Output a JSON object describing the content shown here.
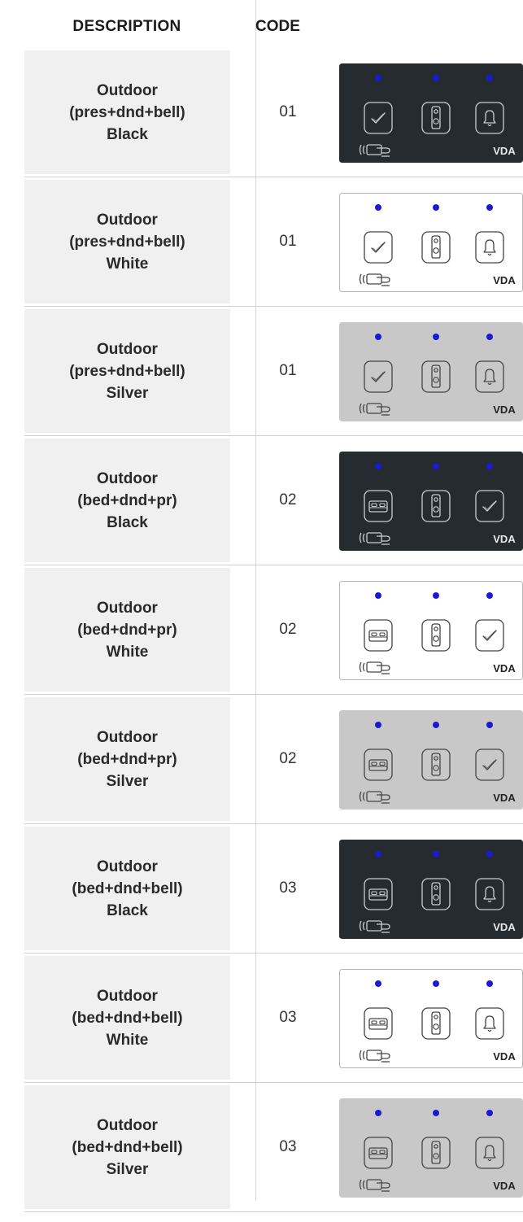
{
  "header": {
    "description": "DESCRIPTION",
    "code": "CODE"
  },
  "colors": {
    "black": "#262b30",
    "white": "#ffffff",
    "silver": "#c8c8c8",
    "led": "#1a1ad6"
  },
  "rows": [
    {
      "line1": "Outdoor",
      "line2": "(pres+dnd+bell)",
      "line3": "Black",
      "code": "01",
      "finish": "black",
      "icons": [
        "check-icon",
        "door-hanger-icon",
        "bell-icon"
      ]
    },
    {
      "line1": "Outdoor",
      "line2": "(pres+dnd+bell)",
      "line3": "White",
      "code": "01",
      "finish": "white",
      "icons": [
        "check-icon",
        "door-hanger-icon",
        "bell-icon"
      ]
    },
    {
      "line1": "Outdoor",
      "line2": "(pres+dnd+bell)",
      "line3": "Silver",
      "code": "01",
      "finish": "silver",
      "icons": [
        "check-icon",
        "door-hanger-icon",
        "bell-icon"
      ]
    },
    {
      "line1": "Outdoor",
      "line2": "(bed+dnd+pr)",
      "line3": "Black",
      "code": "02",
      "finish": "black",
      "icons": [
        "bed-icon",
        "door-hanger-icon",
        "check-icon"
      ]
    },
    {
      "line1": "Outdoor",
      "line2": "(bed+dnd+pr)",
      "line3": "White",
      "code": "02",
      "finish": "white",
      "icons": [
        "bed-icon",
        "door-hanger-icon",
        "check-icon"
      ]
    },
    {
      "line1": "Outdoor",
      "line2": "(bed+dnd+pr)",
      "line3": "Silver",
      "code": "02",
      "finish": "silver",
      "icons": [
        "bed-icon",
        "door-hanger-icon",
        "check-icon"
      ]
    },
    {
      "line1": "Outdoor",
      "line2": "(bed+dnd+bell)",
      "line3": "Black",
      "code": "03",
      "finish": "black",
      "icons": [
        "bed-icon",
        "door-hanger-icon",
        "bell-icon"
      ]
    },
    {
      "line1": "Outdoor",
      "line2": "(bed+dnd+bell)",
      "line3": "White",
      "code": "03",
      "finish": "white",
      "icons": [
        "bed-icon",
        "door-hanger-icon",
        "bell-icon"
      ]
    },
    {
      "line1": "Outdoor",
      "line2": "(bed+dnd+bell)",
      "line3": "Silver",
      "code": "03",
      "finish": "silver",
      "icons": [
        "bed-icon",
        "door-hanger-icon",
        "bell-icon"
      ]
    }
  ],
  "panel": {
    "logo": "VDA"
  }
}
